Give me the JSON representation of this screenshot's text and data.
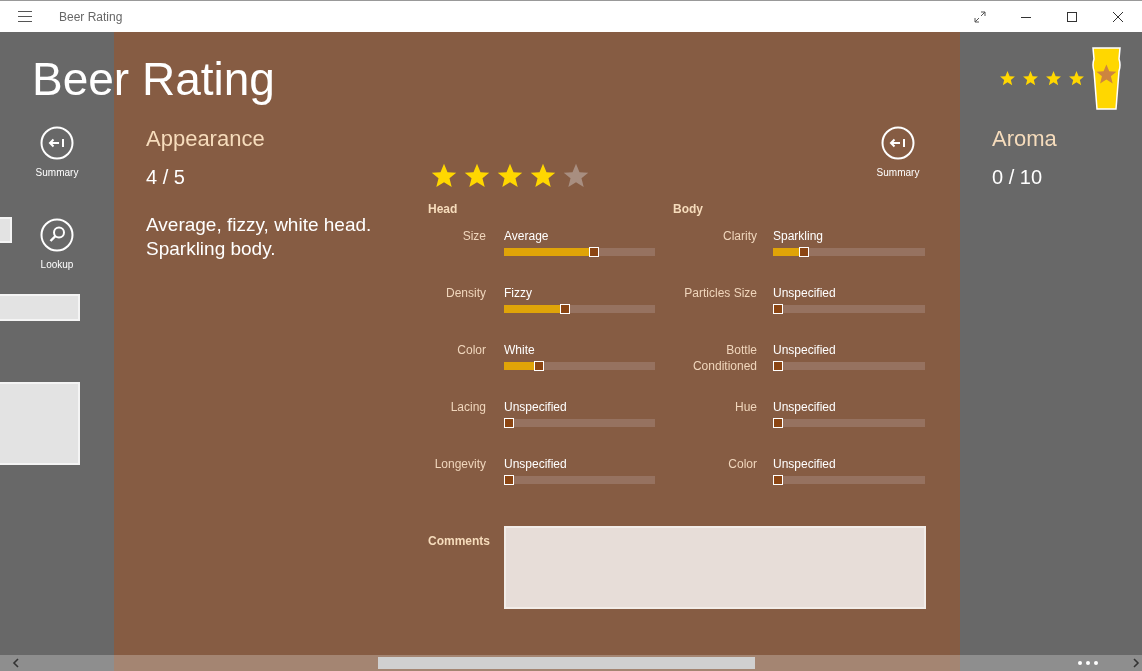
{
  "window": {
    "title": "Beer Rating"
  },
  "page_title": "Beer Rating",
  "header_rating": {
    "stars": 4
  },
  "left_panel": {
    "buttons": [
      {
        "label": "Summary",
        "kind": "back"
      },
      {
        "label": "Lookup",
        "kind": "search"
      }
    ]
  },
  "appearance": {
    "title": "Appearance",
    "score": "4 / 5",
    "description": "Average, fizzy, white head. Sparkling body.",
    "stars": 4,
    "summary_button": {
      "label": "Summary"
    },
    "groups": [
      {
        "title": "Head",
        "fields": [
          {
            "label": "Size",
            "value": "Average",
            "level": 0.6
          },
          {
            "label": "Density",
            "value": "Fizzy",
            "level": 0.4
          },
          {
            "label": "Color",
            "value": "White",
            "level": 0.21
          },
          {
            "label": "Lacing",
            "value": "Unspecified",
            "level": 0
          },
          {
            "label": "Longevity",
            "value": "Unspecified",
            "level": 0
          }
        ]
      },
      {
        "title": "Body",
        "fields": [
          {
            "label": "Clarity",
            "value": "Sparkling",
            "level": 0.18
          },
          {
            "label": "Particles Size",
            "value": "Unspecified",
            "level": 0
          },
          {
            "label": "Bottle Conditioned",
            "value": "Unspecified",
            "level": 0
          },
          {
            "label": "Hue",
            "value": "Unspecified",
            "level": 0
          },
          {
            "label": "Color",
            "value": "Unspecified",
            "level": 0
          }
        ]
      }
    ],
    "comments": {
      "label": "Comments"
    }
  },
  "aroma": {
    "title": "Aroma",
    "score": "0 / 10"
  }
}
